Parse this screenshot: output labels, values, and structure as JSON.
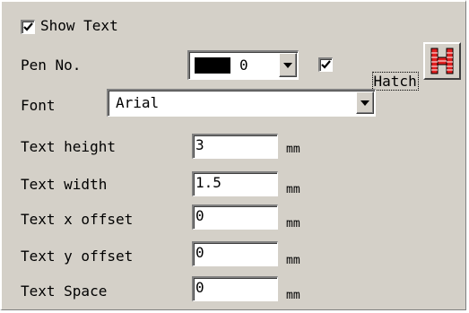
{
  "text_panel": {
    "show_text": {
      "label": "Show Text",
      "checked": true
    },
    "pen_no": {
      "label": "Pen No.",
      "value": "0",
      "swatch_color": "#000000"
    },
    "hatch": {
      "label": "Hatch",
      "checked": true,
      "button_icon": "hatch-pattern-icon",
      "icon_color": "#e02020"
    },
    "font": {
      "label": "Font",
      "value": "Arial"
    },
    "fields": [
      {
        "label": "Text height",
        "value": "3",
        "unit": "mm"
      },
      {
        "label": "Text width",
        "value": "1.5",
        "unit": "mm"
      },
      {
        "label": "Text x offset",
        "value": "0",
        "unit": "mm"
      },
      {
        "label": "Text y offset",
        "value": "0",
        "unit": "mm"
      },
      {
        "label": "Text Space",
        "value": "0",
        "unit": "mm"
      }
    ]
  }
}
